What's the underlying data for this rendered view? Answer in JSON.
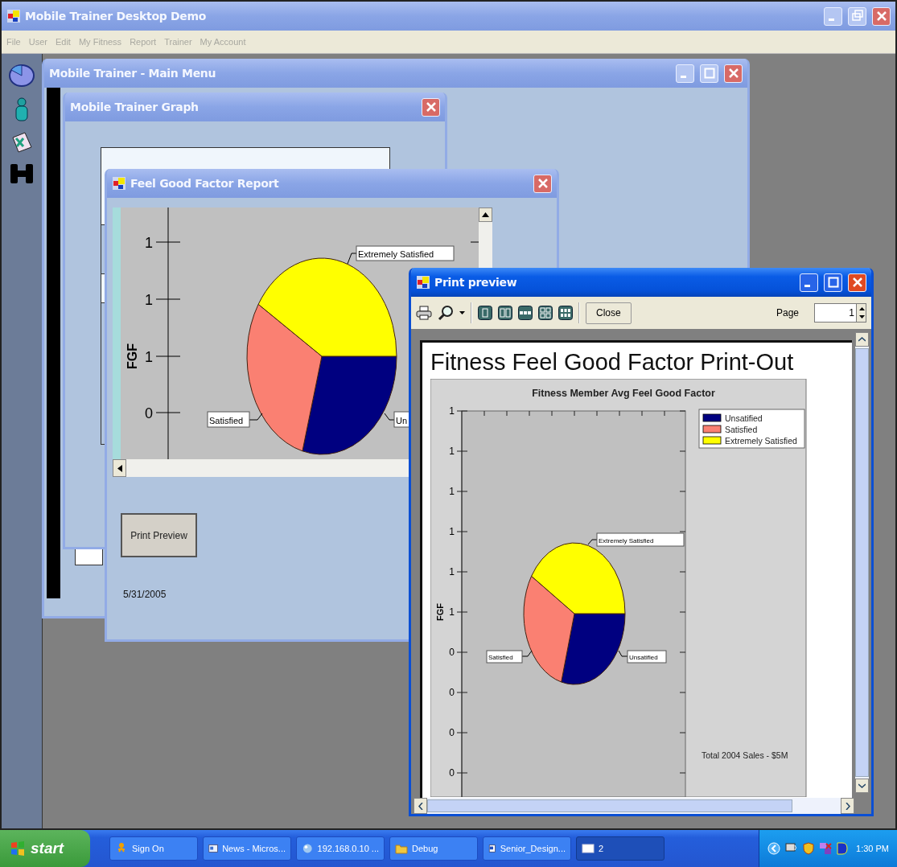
{
  "app_window": {
    "title": "Mobile Trainer Desktop Demo",
    "active": false
  },
  "menu_bar": [
    "File",
    "User",
    "Edit",
    "My Fitness",
    "Report",
    "Trainer",
    "My Account"
  ],
  "main_menu_window": {
    "title": "Mobile Trainer - Main Menu",
    "active": false
  },
  "graph_window": {
    "title": "Mobile Trainer Graph",
    "active": false
  },
  "report_window": {
    "title": "Feel Good Factor Report",
    "active": false,
    "chart": {
      "ylabel": "FGF",
      "yticks": [
        "1",
        "1",
        "1",
        "0"
      ],
      "slice_labels": [
        "Extremely Satisfied",
        "Satisfied",
        "Un"
      ]
    },
    "button": "Print Preview",
    "date": "5/31/2005"
  },
  "print_preview_window": {
    "title": "Print preview",
    "active": true,
    "close_button": "Close",
    "page_label": "Page",
    "page_value": "1",
    "document": {
      "title": "Fitness Feel Good Factor Print-Out",
      "chart": {
        "title": "Fitness Member Avg Feel Good Factor",
        "ylabel": "FGF",
        "yticks": [
          "1",
          "1",
          "1",
          "1",
          "1",
          "1",
          "0",
          "0",
          "0",
          "0"
        ],
        "slice_labels": [
          "Extremely Satisfied",
          "Satisfied",
          "Unsatified"
        ],
        "legend": [
          {
            "label": "Unsatified",
            "color": "#000080"
          },
          {
            "label": "Satisfied",
            "color": "#fa8072"
          },
          {
            "label": "Extremely Satisfied",
            "color": "#ffff00"
          }
        ]
      },
      "footer": "Total 2004 Sales - $5M"
    }
  },
  "taskbar": {
    "start": "start",
    "items": [
      {
        "label": "Sign On",
        "selected": false
      },
      {
        "label": "News - Micros...",
        "selected": false
      },
      {
        "label": "192.168.0.10 ...",
        "selected": false
      },
      {
        "label": "Debug",
        "selected": false
      },
      {
        "label": "Senior_Design...",
        "selected": false
      },
      {
        "label": "2",
        "selected": true
      }
    ],
    "clock": "1:30 PM"
  }
}
